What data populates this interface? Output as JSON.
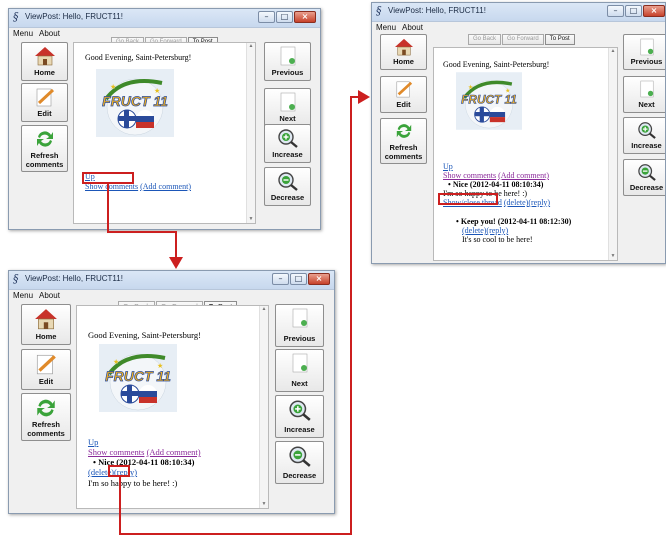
{
  "window": {
    "title": "ViewPost: Hello, FRUCT11!",
    "close_glyph": "×",
    "min_glyph": "–",
    "max_glyph": "□"
  },
  "menu": [
    "Menu",
    "About"
  ],
  "nav": {
    "back": "Go Back",
    "forward": "Go Forward",
    "to_post": "To Post"
  },
  "sidebar_left": {
    "home": "Home",
    "edit": "Edit",
    "refresh": "Refresh comments"
  },
  "sidebar_right": {
    "previous": "Previous",
    "next": "Next",
    "increase": "Increase",
    "decrease": "Decrease"
  },
  "logo_text": "FRUCT 11",
  "post": {
    "greeting": "Good Evening, Saint-Petersburg!",
    "up": "Up",
    "show_comments": "Show comments",
    "add_comment": "(Add comment)",
    "comment1_title": "Nice (2012-04-11 08:10:34)",
    "comment1_body": "I'm so happy to be here! :)",
    "delete": "(delete)",
    "reply": "(reply)",
    "show_close_thread": "Show/close thread",
    "reply1_title": "Keep you! (2012-04-11 08:12:30)",
    "reply1_body": "It's so cool to be here!",
    "delete_reply": "(delete)(reply)"
  },
  "colors": {
    "highlight": "#cc1f1f",
    "link": "#1b56b8",
    "visited": "#8a2a9a",
    "titlebar": "#c7d8ee"
  }
}
